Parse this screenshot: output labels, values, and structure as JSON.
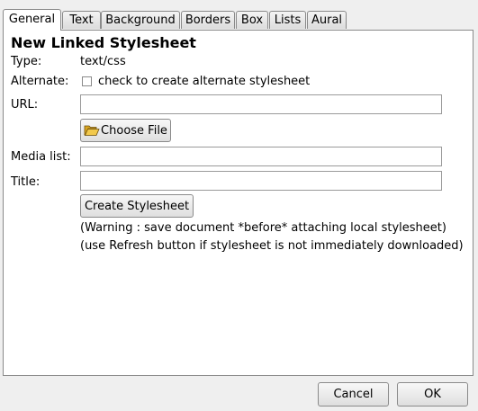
{
  "tabs": [
    {
      "label": "General",
      "active": true
    },
    {
      "label": "Text"
    },
    {
      "label": "Background"
    },
    {
      "label": "Borders"
    },
    {
      "label": "Box"
    },
    {
      "label": "Lists"
    },
    {
      "label": "Aural"
    }
  ],
  "panel": {
    "heading": "New Linked Stylesheet",
    "type_label": "Type:",
    "type_value": "text/css",
    "alternate_label": "Alternate:",
    "alternate_checkbox_label": "check to create alternate stylesheet",
    "alternate_checked": false,
    "url_label": "URL:",
    "url_value": "",
    "choose_file_label": "Choose File",
    "media_label": "Media list:",
    "media_value": "",
    "title_label": "Title:",
    "title_value": "",
    "create_label": "Create Stylesheet",
    "warning": "(Warning : save document *before* attaching local stylesheet)",
    "refresh_note": "(use Refresh button if stylesheet is not immediately downloaded)"
  },
  "footer": {
    "cancel_label": "Cancel",
    "ok_label": "OK"
  },
  "icons": {
    "choose_file": "open-folder-icon"
  }
}
